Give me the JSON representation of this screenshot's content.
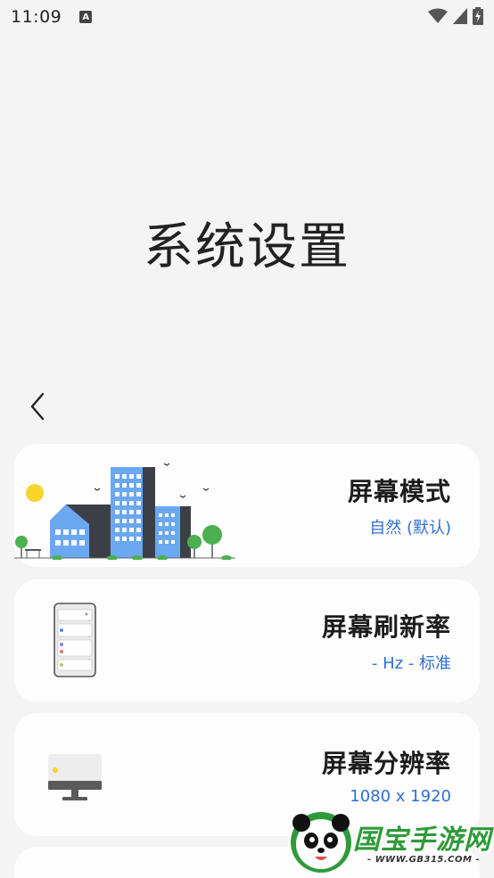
{
  "status_bar": {
    "time": "11:09",
    "notification_icon_letter": "A",
    "icons": [
      "wifi-icon",
      "signal-icon",
      "battery-charging-icon"
    ]
  },
  "page": {
    "title": "系统设置",
    "back_icon": "chevron-left-icon"
  },
  "settings": [
    {
      "title": "屏幕模式",
      "value": "自然 (默认)",
      "illustration": "city-illustration"
    },
    {
      "title": "屏幕刷新率",
      "value": "- Hz - 标准",
      "illustration": "phone-illustration"
    },
    {
      "title": "屏幕分辨率",
      "value": "1080 x 1920",
      "illustration": "monitor-illustration"
    }
  ],
  "watermark": {
    "logo_text": "国宝手游网",
    "url": "- WWW.GB315.COM -"
  },
  "colors": {
    "background": "#f4f4f4",
    "card": "#fdfdfd",
    "accent_blue": "#2f6fd3",
    "title_text": "#1c1c1c"
  }
}
